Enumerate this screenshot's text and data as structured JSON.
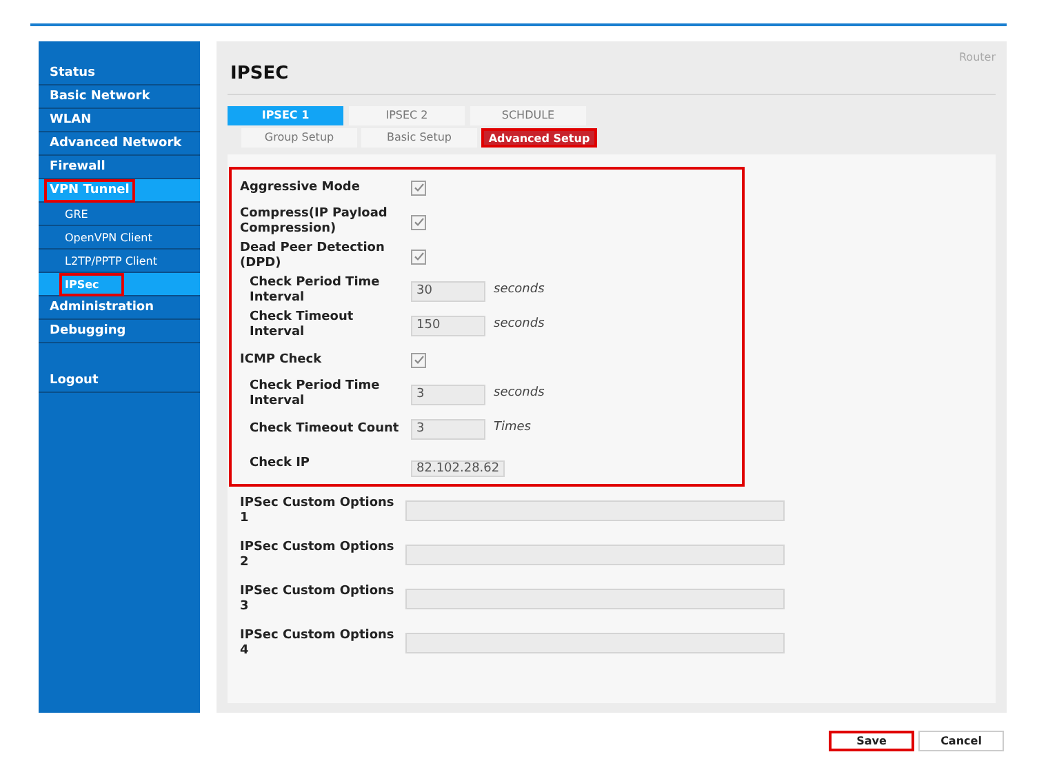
{
  "sidebar": {
    "items": [
      {
        "label": "Status",
        "selected": false,
        "highlighted": false,
        "kind": "main"
      },
      {
        "label": "Basic Network",
        "selected": false,
        "highlighted": false,
        "kind": "main"
      },
      {
        "label": "WLAN",
        "selected": false,
        "highlighted": false,
        "kind": "main"
      },
      {
        "label": "Advanced Network",
        "selected": false,
        "highlighted": false,
        "kind": "main"
      },
      {
        "label": "Firewall",
        "selected": false,
        "highlighted": false,
        "kind": "main"
      },
      {
        "label": "VPN Tunnel",
        "selected": true,
        "highlighted": true,
        "kind": "main"
      },
      {
        "label": "GRE",
        "selected": false,
        "highlighted": false,
        "kind": "sub"
      },
      {
        "label": "OpenVPN Client",
        "selected": false,
        "highlighted": false,
        "kind": "sub"
      },
      {
        "label": "L2TP/PPTP Client",
        "selected": false,
        "highlighted": false,
        "kind": "sub"
      },
      {
        "label": "IPSec",
        "selected": true,
        "highlighted": true,
        "kind": "sub"
      },
      {
        "label": "Administration",
        "selected": false,
        "highlighted": false,
        "kind": "main"
      },
      {
        "label": "Debugging",
        "selected": false,
        "highlighted": false,
        "kind": "main"
      },
      {
        "label": "Logout",
        "selected": false,
        "highlighted": false,
        "kind": "logout"
      }
    ]
  },
  "header": {
    "title": "IPSEC",
    "device": "Router"
  },
  "tabs": [
    {
      "label": "IPSEC 1",
      "selected": true
    },
    {
      "label": "IPSEC 2",
      "selected": false
    },
    {
      "label": "SCHDULE",
      "selected": false
    }
  ],
  "subtabs": [
    {
      "label": "Group Setup",
      "selected": false,
      "highlighted": false
    },
    {
      "label": "Basic Setup",
      "selected": false,
      "highlighted": false
    },
    {
      "label": "Advanced Setup",
      "selected": true,
      "highlighted": true
    }
  ],
  "highlighted_fields": [
    {
      "kind": "checkbox",
      "label": "Aggressive Mode",
      "checked": true,
      "indented": false
    },
    {
      "kind": "checkbox",
      "label": "Compress(IP Payload Compression)",
      "checked": true,
      "indented": false
    },
    {
      "kind": "checkbox",
      "label": "Dead Peer Detection (DPD)",
      "checked": true,
      "indented": false
    },
    {
      "kind": "number",
      "label": "Check Period Time Interval",
      "value": "30",
      "unit": "seconds",
      "indented": true
    },
    {
      "kind": "number",
      "label": "Check Timeout Interval",
      "value": "150",
      "unit": "seconds",
      "indented": true
    },
    {
      "kind": "checkbox",
      "label": "ICMP Check",
      "checked": true,
      "indented": false
    },
    {
      "kind": "number",
      "label": "Check Period Time Interval",
      "value": "3",
      "unit": "seconds",
      "indented": true
    },
    {
      "kind": "number",
      "label": "Check Timeout Count",
      "value": "3",
      "unit": "Times",
      "indented": true
    },
    {
      "kind": "text",
      "label": "Check IP",
      "value": "82.102.28.62",
      "indented": true
    }
  ],
  "custom_options": [
    {
      "label": "IPSec Custom Options 1"
    },
    {
      "label": "IPSec Custom Options 2"
    },
    {
      "label": "IPSec Custom Options 3"
    },
    {
      "label": "IPSec Custom Options 4"
    }
  ],
  "buttons": [
    {
      "label": "Save",
      "highlighted": true
    },
    {
      "label": "Cancel",
      "highlighted": false
    }
  ]
}
